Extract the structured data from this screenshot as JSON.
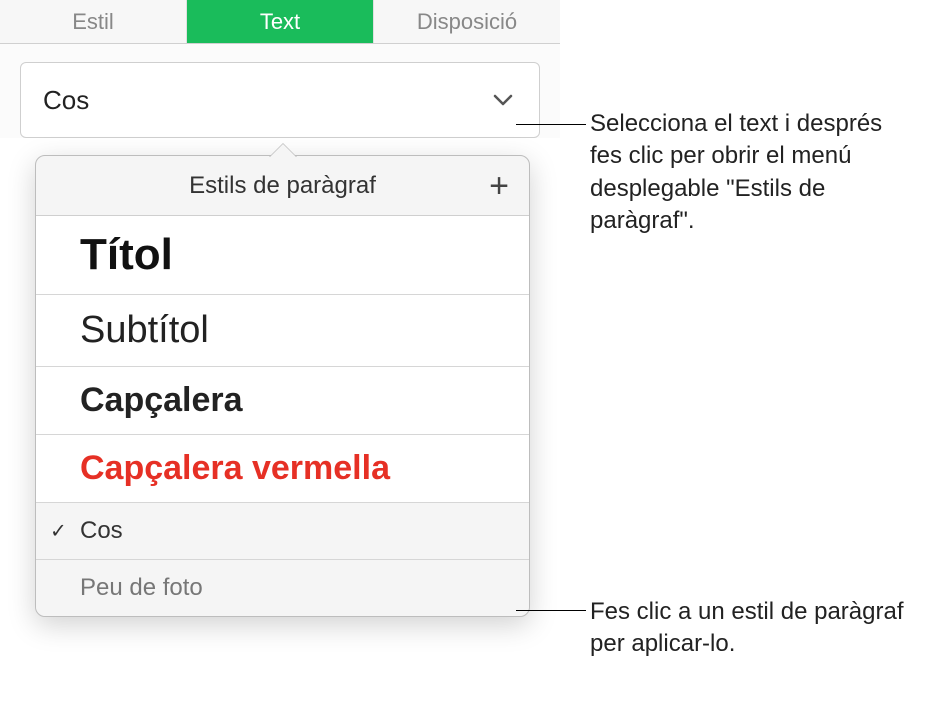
{
  "tabs": {
    "estil": "Estil",
    "text": "Text",
    "disposicio": "Disposició"
  },
  "style_selector": {
    "current": "Cos"
  },
  "popover": {
    "title": "Estils de paràgraf",
    "items": [
      {
        "label": "Títol",
        "class": "style-titol",
        "checked": false
      },
      {
        "label": "Subtítol",
        "class": "style-subtitol",
        "checked": false
      },
      {
        "label": "Capçalera",
        "class": "style-capcalera",
        "checked": false
      },
      {
        "label": "Capçalera vermella",
        "class": "style-capcalera-vermella",
        "checked": false
      },
      {
        "label": "Cos",
        "class": "style-cos",
        "checked": true
      },
      {
        "label": "Peu de foto",
        "class": "style-peu",
        "checked": false
      }
    ]
  },
  "callouts": {
    "c1": "Selecciona el text i després fes clic per obrir el menú desplegable \"Estils de paràgraf\".",
    "c2": "Fes clic a un estil de paràgraf per aplicar-lo."
  }
}
